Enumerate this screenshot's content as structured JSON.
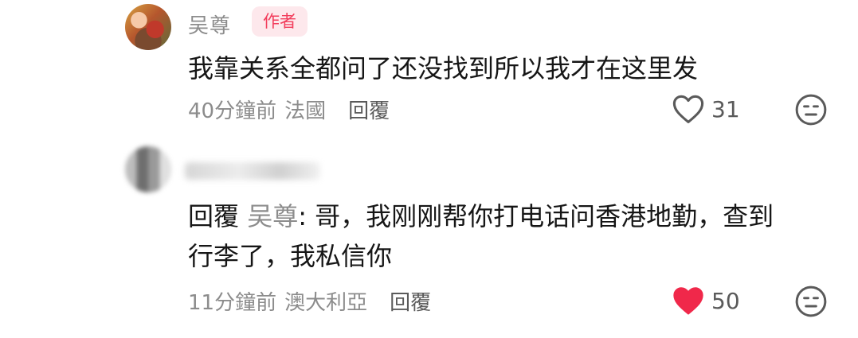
{
  "comments": [
    {
      "username": "吴尊",
      "badge": "作者",
      "text": "我靠关系全都问了还没找到所以我才在这里发",
      "time": "40分鐘前",
      "location": "法國",
      "reply_label": "回覆",
      "likes": "31",
      "liked": false
    },
    {
      "username": "",
      "reply_prefix": "回覆",
      "reply_to": "吴尊",
      "text_line1": ": 哥，我刚刚帮你打电话问香港地勤，查到",
      "text_line2": "行李了，我私信你",
      "time": "11分鐘前",
      "location": "澳大利亞",
      "reply_label": "回覆",
      "likes": "50",
      "liked": true
    }
  ],
  "colors": {
    "badge_text": "#f23d5c",
    "badge_bg": "#fde8ec",
    "liked_heart": "#f0284a",
    "muted": "#8c8c8c"
  },
  "icons": {
    "like": "heart-icon",
    "emoji": "neutral-face-icon"
  }
}
